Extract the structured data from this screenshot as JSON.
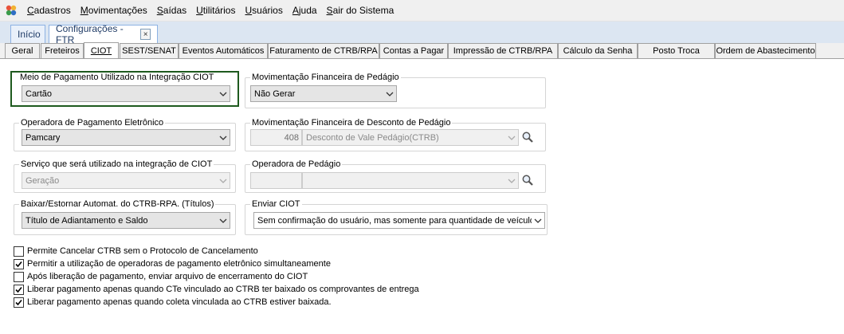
{
  "menu": {
    "items": [
      "Cadastros",
      "Movimentações",
      "Saídas",
      "Utilitários",
      "Usuários",
      "Ajuda",
      "Sair do Sistema"
    ]
  },
  "doc_tabs": {
    "home": "Início",
    "config": "Configurações - FTR",
    "close_symbol": "×"
  },
  "tabs": [
    "Geral",
    "Freteiros",
    "CIOT",
    "SEST/SENAT",
    "Eventos Automáticos",
    "Faturamento de CTRB/RPA",
    "Contas a Pagar",
    "Impressão de CTRB/RPA",
    "Cálculo da Senha",
    "Posto Troca",
    "Ordem de Abastecimento"
  ],
  "active_tab": "CIOT",
  "fields": {
    "meio_pagamento": {
      "label": "Meio de Pagamento Utilizado na Integração CIOT",
      "value": "Cartão"
    },
    "mov_pedagio": {
      "label": "Movimentação Financeira de Pedágio",
      "value": "Não Gerar"
    },
    "operadora_pagamento": {
      "label": "Operadora de Pagamento Eletrônico",
      "value": "Pamcary"
    },
    "mov_desconto_pedagio": {
      "label": "Movimentação Financeira de Desconto de  Pedágio",
      "code": "408",
      "value": "Desconto de Vale Pedágio(CTRB)"
    },
    "servico": {
      "label": "Serviço que será utilizado na integração de CIOT",
      "value": "Geração"
    },
    "operadora_pedagio": {
      "label": "Operadora de Pedágio",
      "code": "",
      "value": ""
    },
    "baixar_estornar": {
      "label": "Baixar/Estornar Automat. do CTRB-RPA. (Títulos)",
      "value": "Título de Adiantamento e Saldo"
    },
    "enviar_ciot": {
      "label": "Enviar CIOT",
      "value": "Sem confirmação do usuário, mas somente para quantidade de veículo"
    }
  },
  "checkboxes": [
    {
      "label": "Permite Cancelar CTRB sem o Protocolo de Cancelamento",
      "checked": false
    },
    {
      "label": "Permitir a utilização de operadoras de pagamento eletrônico simultaneamente",
      "checked": true
    },
    {
      "label": "Após liberação de pagamento, enviar arquivo de encerramento do CIOT",
      "checked": false
    },
    {
      "label": "Liberar pagamento apenas quando CTe vinculado ao CTRB ter baixado os comprovantes de entrega",
      "checked": true
    },
    {
      "label": "Liberar pagamento apenas quando coleta vinculada ao CTRB estiver baixada.",
      "checked": true
    }
  ],
  "colors": {
    "highlight": "#1e5a1e",
    "doc_tab_border": "#8db2e3",
    "doc_tab_bar": "#dce6f2"
  }
}
